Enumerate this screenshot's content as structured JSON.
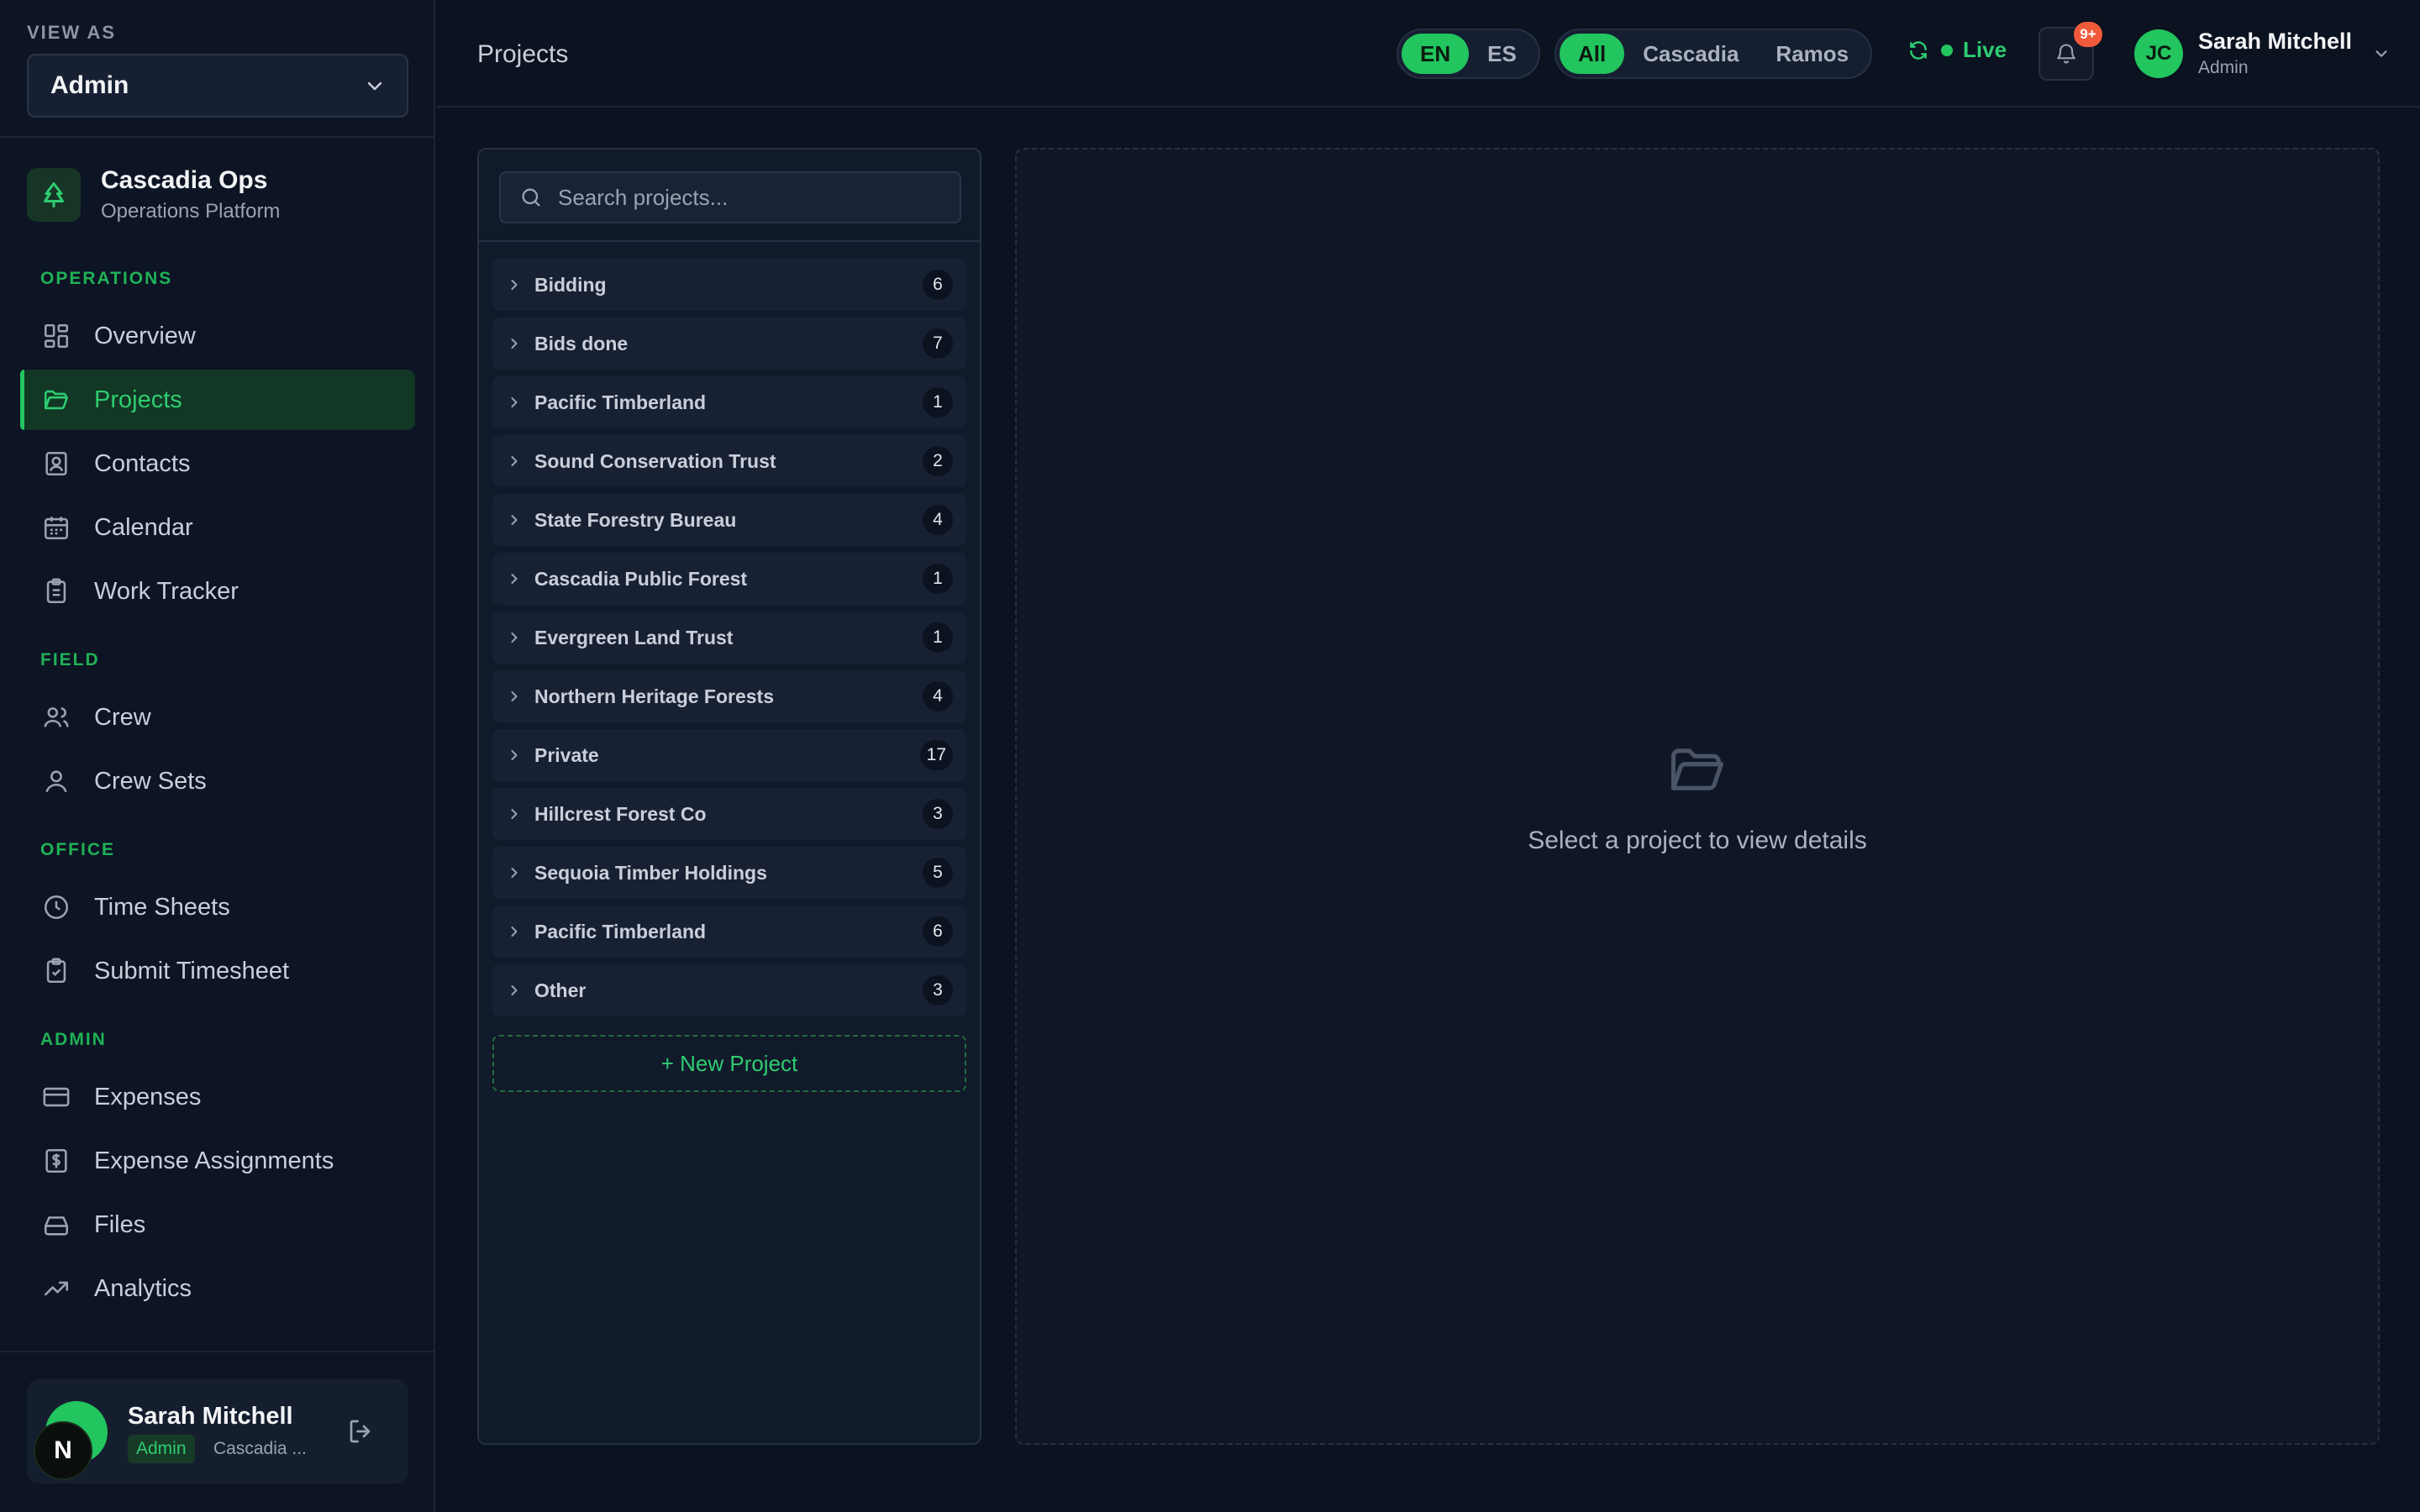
{
  "sidebar": {
    "view_as_label": "VIEW AS",
    "view_as_value": "Admin",
    "brand_name": "Cascadia Ops",
    "brand_sub": "Operations Platform",
    "sections": {
      "operations": "OPERATIONS",
      "field": "FIELD",
      "office": "OFFICE",
      "admin": "ADMIN"
    },
    "items": {
      "overview": "Overview",
      "projects": "Projects",
      "contacts": "Contacts",
      "calendar": "Calendar",
      "work_tracker": "Work Tracker",
      "crew": "Crew",
      "crew_sets": "Crew Sets",
      "time_sheets": "Time Sheets",
      "submit_timesheet": "Submit Timesheet",
      "expenses": "Expenses",
      "expense_assignments": "Expense Assignments",
      "files": "Files",
      "analytics": "Analytics"
    },
    "active_item": "Projects",
    "user": {
      "name": "Sarah Mitchell",
      "role": "Admin",
      "org": "Cascadia ...",
      "badge_letter": "N"
    }
  },
  "header": {
    "title": "Projects",
    "languages": [
      "EN",
      "ES"
    ],
    "active_language": "EN",
    "filters": [
      "All",
      "Cascadia",
      "Ramos"
    ],
    "active_filter": "All",
    "live_label": "Live",
    "notification_count": "9+",
    "user": {
      "initials": "JC",
      "name": "Sarah Mitchell",
      "role": "Admin"
    }
  },
  "projects": {
    "search_placeholder": "Search projects...",
    "groups": [
      {
        "name": "Bidding",
        "count": "6"
      },
      {
        "name": "Bids done",
        "count": "7"
      },
      {
        "name": "Pacific Timberland",
        "count": "1"
      },
      {
        "name": "Sound Conservation Trust",
        "count": "2"
      },
      {
        "name": "State Forestry Bureau",
        "count": "4"
      },
      {
        "name": "Cascadia Public Forest",
        "count": "1"
      },
      {
        "name": "Evergreen Land Trust",
        "count": "1"
      },
      {
        "name": "Northern Heritage Forests",
        "count": "4"
      },
      {
        "name": "Private",
        "count": "17"
      },
      {
        "name": "Hillcrest Forest Co",
        "count": "3"
      },
      {
        "name": "Sequoia Timber Holdings",
        "count": "5"
      },
      {
        "name": "Pacific Timberland",
        "count": "6"
      },
      {
        "name": "Other",
        "count": "3"
      }
    ],
    "new_project_label": "+ New Project"
  },
  "detail": {
    "empty_message": "Select a project to view details"
  },
  "colors": {
    "accent": "#22c55e",
    "background": "#0b1220",
    "badge": "#f05a3a"
  }
}
